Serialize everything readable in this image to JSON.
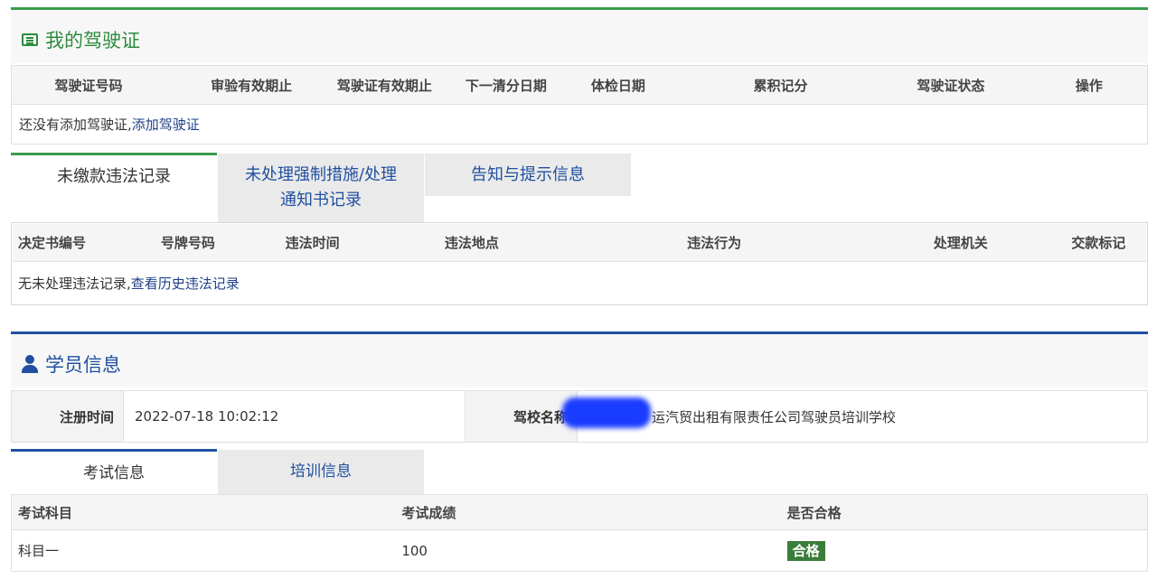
{
  "license_panel": {
    "title": "我的驾驶证",
    "columns": [
      "驾驶证号码",
      "审验有效期止",
      "驾驶证有效期止",
      "下一清分日期",
      "体检日期",
      "累积记分",
      "驾驶证状态",
      "操作"
    ],
    "empty_text": "还没有添加驾驶证,",
    "add_link": "添加驾驶证"
  },
  "violation_tabs": [
    {
      "label": "未缴款违法记录",
      "active": true
    },
    {
      "label_line1": "未处理强制措施/处理",
      "label_line2": "通知书记录",
      "active": false
    },
    {
      "label": "告知与提示信息",
      "active": false
    }
  ],
  "violation_table": {
    "columns": [
      "决定书编号",
      "号牌号码",
      "违法时间",
      "违法地点",
      "违法行为",
      "处理机关",
      "交款标记"
    ],
    "empty_text": "无未处理违法记录,",
    "history_link": "查看历史违法记录"
  },
  "student_panel": {
    "title": "学员信息",
    "reg_label": "注册时间",
    "reg_value": "2022-07-18 10:02:12",
    "school_label": "驾校名称",
    "school_value": "运汽贸出租有限责任公司驾驶员培训学校"
  },
  "exam_tabs": [
    {
      "label": "考试信息",
      "active": true
    },
    {
      "label": "培训信息",
      "active": false
    }
  ],
  "exam_table": {
    "columns": [
      "考试科目",
      "考试成绩",
      "是否合格"
    ],
    "rows": [
      {
        "subject": "科目一",
        "score": "100",
        "result": "合格"
      }
    ]
  },
  "colors": {
    "green": "#2e8b3d",
    "blue": "#1f4f9f",
    "badge": "#3a7d3a",
    "redaction": "#1a3cff"
  },
  "icons": {
    "license_title": "list-icon",
    "student_title": "user-icon"
  }
}
